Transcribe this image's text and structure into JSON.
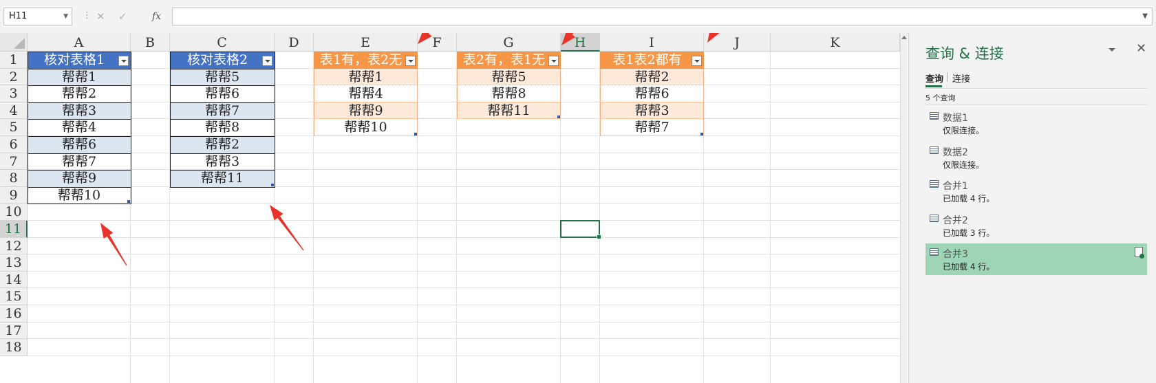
{
  "formula_bar": {
    "name_box": "H11",
    "cancel_glyph": "✕",
    "enter_glyph": "✓",
    "fx_label": "fx",
    "formula_value": ""
  },
  "sheet": {
    "columns": [
      "A",
      "B",
      "C",
      "D",
      "E",
      "F",
      "G",
      "H",
      "I",
      "J",
      "K"
    ],
    "selected_column": "H",
    "rows": [
      "1",
      "2",
      "3",
      "4",
      "5",
      "6",
      "7",
      "8",
      "9",
      "10",
      "11",
      "12",
      "13",
      "14",
      "15",
      "16",
      "17",
      "18"
    ],
    "selected_row": "11",
    "selected_cell": "H11",
    "table1": {
      "header": "核对表格1",
      "items": [
        "帮帮1",
        "帮帮2",
        "帮帮3",
        "帮帮4",
        "帮帮6",
        "帮帮7",
        "帮帮9",
        "帮帮10"
      ]
    },
    "table2": {
      "header": "核对表格2",
      "items": [
        "帮帮5",
        "帮帮6",
        "帮帮7",
        "帮帮8",
        "帮帮2",
        "帮帮3",
        "帮帮11"
      ]
    },
    "result1": {
      "header": "表1有，表2无",
      "items": [
        "帮帮1",
        "帮帮4",
        "帮帮9",
        "帮帮10"
      ]
    },
    "result2": {
      "header": "表2有，表1无",
      "items": [
        "帮帮5",
        "帮帮8",
        "帮帮11"
      ]
    },
    "result3": {
      "header": "表1表2都有",
      "items": [
        "帮帮2",
        "帮帮6",
        "帮帮3",
        "帮帮7"
      ]
    }
  },
  "colors": {
    "table_header_blue": "#4472c4",
    "table_band_blue": "#dce6f1",
    "table_header_orange": "#f79646",
    "table_band_orange": "#fde9d9",
    "excel_green": "#217346",
    "annotation_arrow": "#e8332b",
    "query_selected": "#9fd5b7"
  },
  "pane": {
    "title": "查询 & 连接",
    "close_glyph": "✕",
    "tabs": [
      "查询",
      "连接"
    ],
    "active_tab": "查询",
    "count_label": "5 个查询",
    "queries": [
      {
        "name": "数据1",
        "status": "仅限连接。"
      },
      {
        "name": "数据2",
        "status": "仅限连接。"
      },
      {
        "name": "合并1",
        "status": "已加载 4 行。"
      },
      {
        "name": "合并2",
        "status": "已加载 3 行。"
      },
      {
        "name": "合并3",
        "status": "已加载 4 行。",
        "selected": true
      }
    ]
  }
}
